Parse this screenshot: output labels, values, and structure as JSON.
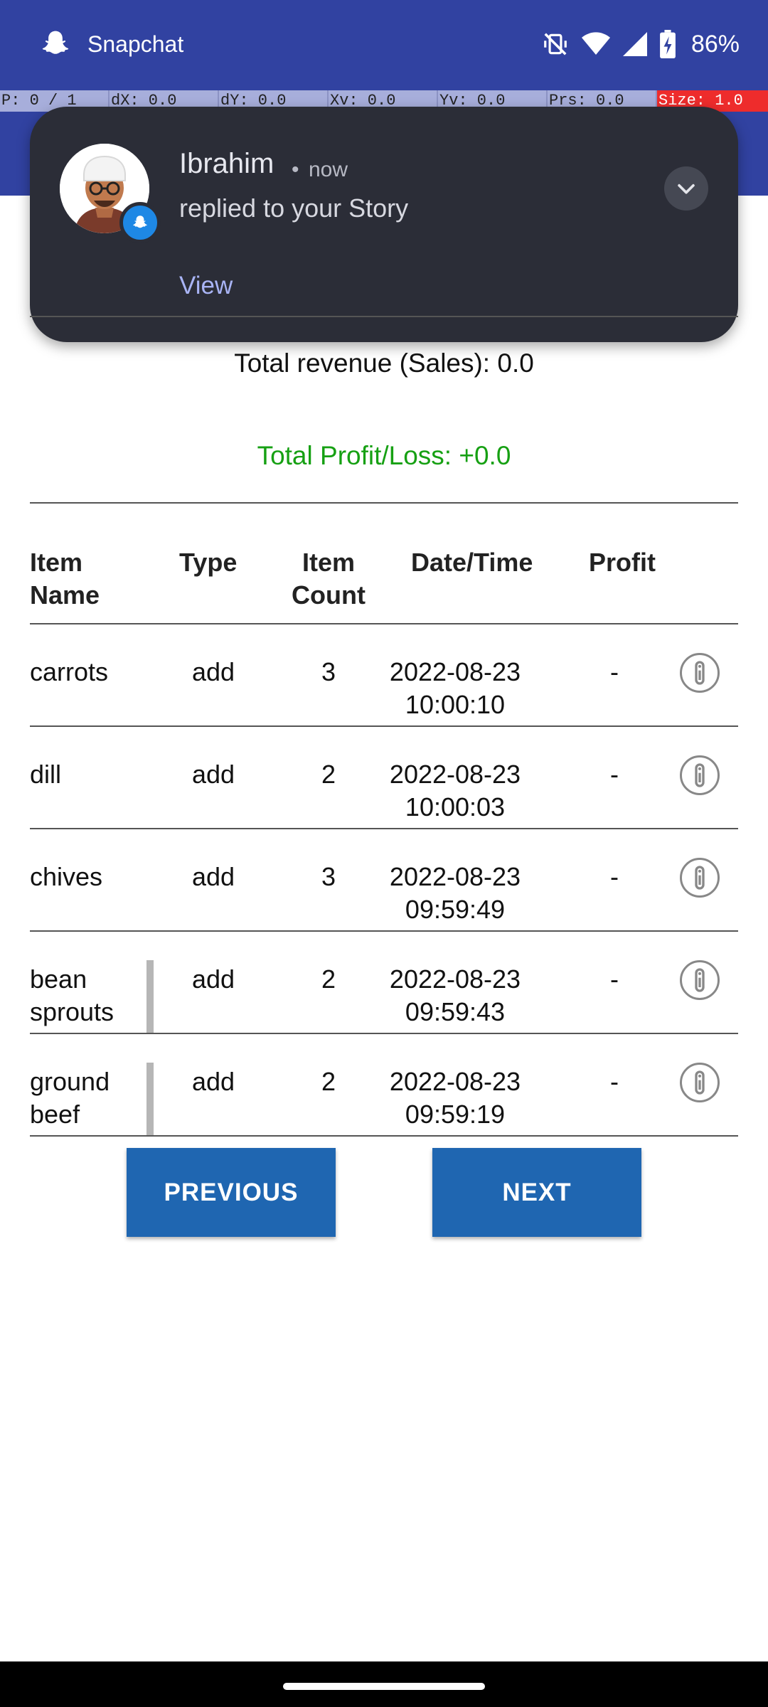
{
  "status_bar": {
    "app_label": "Snapchat",
    "battery": "86%",
    "icons": [
      "snapchat-ghost-icon",
      "vibrate-off-icon",
      "wifi-icon",
      "signal-icon",
      "battery-charging-icon"
    ]
  },
  "pointer_bar": {
    "p": "P: 0 / 1",
    "dx": "dX: 0.0",
    "dy": "dY: 0.0",
    "xv": "Xv: 0.0",
    "yv": "Yv: 0.0",
    "prs": "Prs: 0.0",
    "size": "Size: 1.0"
  },
  "notification": {
    "sender": "Ibrahim",
    "separator": "•",
    "time": "now",
    "message": "replied to your Story",
    "action": "View"
  },
  "summary": {
    "revenue": "Total revenue (Sales): 0.0",
    "profit": "Total Profit/Loss: +0.0"
  },
  "table": {
    "headers": {
      "name_line1": "Item",
      "name_line2": "Name",
      "type": "Type",
      "count_line1": "Item",
      "count_line2": "Count",
      "datetime": "Date/Time",
      "profit": "Profit"
    },
    "rows": [
      {
        "name1": "carrots",
        "name2": "",
        "type": "add",
        "count": "3",
        "date": "2022-08-23",
        "time": "10:00:10",
        "profit": "-"
      },
      {
        "name1": "dill",
        "name2": "",
        "type": "add",
        "count": "2",
        "date": "2022-08-23",
        "time": "10:00:03",
        "profit": "-"
      },
      {
        "name1": "chives",
        "name2": "",
        "type": "add",
        "count": "3",
        "date": "2022-08-23",
        "time": "09:59:49",
        "profit": "-"
      },
      {
        "name1": "bean",
        "name2": "sprouts",
        "type": "add",
        "count": "2",
        "date": "2022-08-23",
        "time": "09:59:43",
        "profit": "-"
      },
      {
        "name1": "ground",
        "name2": "beef",
        "type": "add",
        "count": "2",
        "date": "2022-08-23",
        "time": "09:59:19",
        "profit": "-"
      }
    ]
  },
  "buttons": {
    "previous": "PREVIOUS",
    "next": "NEXT"
  },
  "colors": {
    "app_bar": "#3142a1",
    "profit_text": "#16a013",
    "button": "#1f66b1",
    "notification_bg": "#2b2d37",
    "notification_action": "#a9b4f5"
  }
}
